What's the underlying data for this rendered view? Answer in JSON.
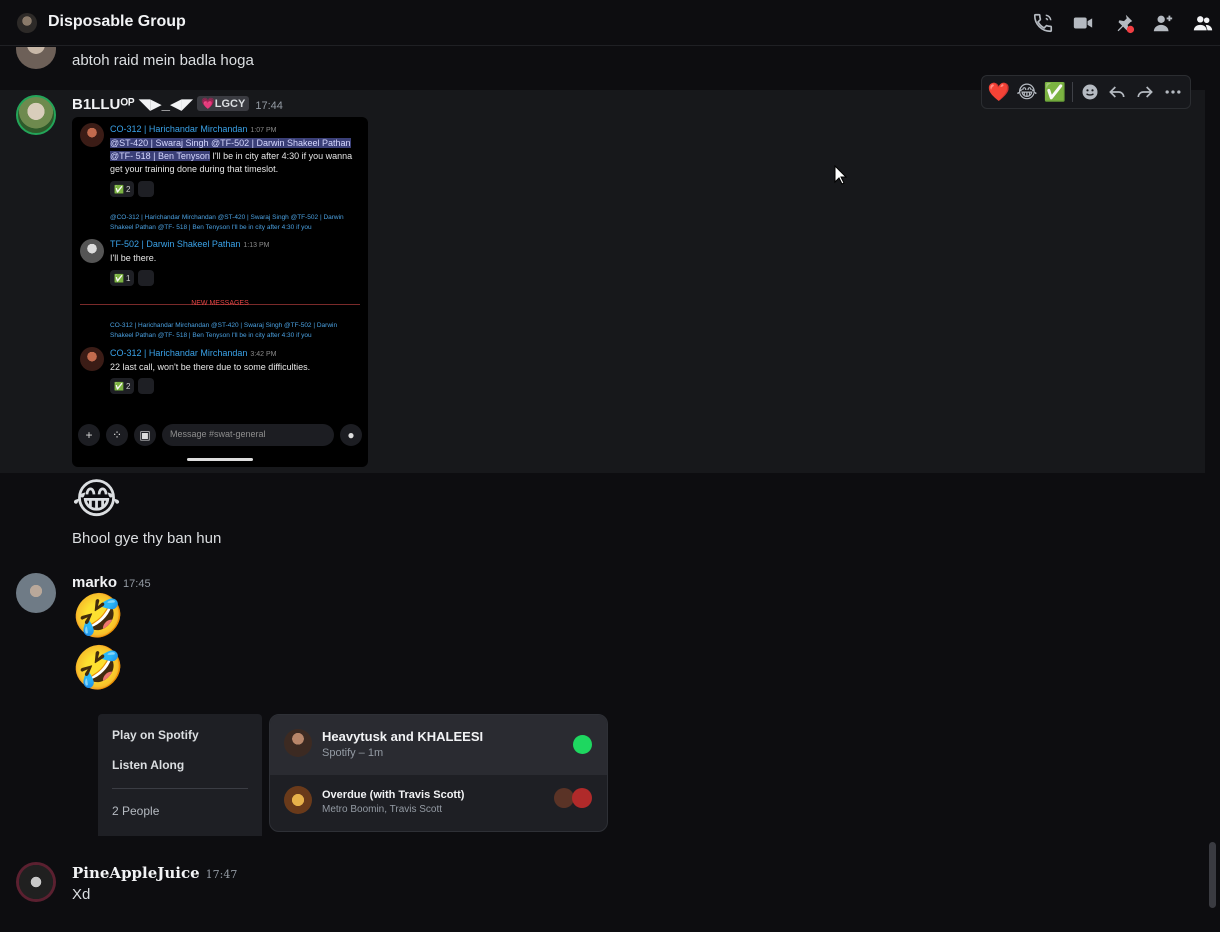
{
  "header": {
    "title": "Disposable Group"
  },
  "colors": {
    "background": "#0d0d10",
    "highlight_row": "#17181b",
    "spotify_green": "#1ed760",
    "link_blue": "#3aa2e8",
    "new_messages_red": "#e24444"
  },
  "messages": [
    {
      "text": "abtoh raid mein badla hoga"
    },
    {
      "author": "B1LLUᴼᴾ ◥▶_◀◤",
      "tag": "💗LGCY",
      "time": "17:44"
    },
    {
      "text": "Bhool gye thy ban hun",
      "emoji": "😂"
    },
    {
      "author": "marko",
      "time": "17:45",
      "emoji1": "🤣",
      "emoji2": "🤣"
    },
    {
      "author": "PineAppleJuice",
      "time": "17:47",
      "text": "Xd"
    }
  ],
  "toolbar": {
    "r1": "❤️",
    "r2": "😂",
    "r3": "✅"
  },
  "screenshot": {
    "m1": {
      "name": "CO-312 | Harichandar Mirchandan",
      "time": "1:07 PM",
      "mention": "@ST-420 | Swaraj Singh @TF-502 | Darwin Shakeel Pathan @TF- 518 | Ben Tenyson",
      "text": " I'll be in city after 4:30  if you wanna get your training done during that timeslot.",
      "count": "2"
    },
    "m2": {
      "reply": "@CO-312 | Harichandar Mirchandan @ST-420 | Swaraj Singh @TF-502 | Darwin Shakeel Pathan @TF- 518 | Ben Tenyson I'll be in city after 4:30  if you",
      "name": "TF-502 | Darwin Shakeel Pathan",
      "time": "1:13 PM",
      "text": "I'll be there.",
      "count": "1"
    },
    "new_messages": "NEW MESSAGES",
    "m3": {
      "reply": "CO-312 | Harichandar Mirchandan @ST-420 | Swaraj Singh @TF-502 | Darwin Shakeel Pathan @TF- 518 | Ben Tenyson I'll be in city after 4:30  if you",
      "name": "CO-312 | Harichandar Mirchandan",
      "time": "3:42 PM",
      "text": "22 last call, won't be there due to some difficulties.",
      "count": "2"
    },
    "input_placeholder": "Message #swat-general"
  },
  "spotify_menu": {
    "play": "Play on Spotify",
    "listen": "Listen Along",
    "people": "2 People"
  },
  "spotify_card": {
    "title": "Heavytusk and KHALEESI",
    "subtitle": "Spotify – 1m",
    "track": "Overdue (with Travis Scott)",
    "artists": "Metro Boomin, Travis Scott"
  }
}
